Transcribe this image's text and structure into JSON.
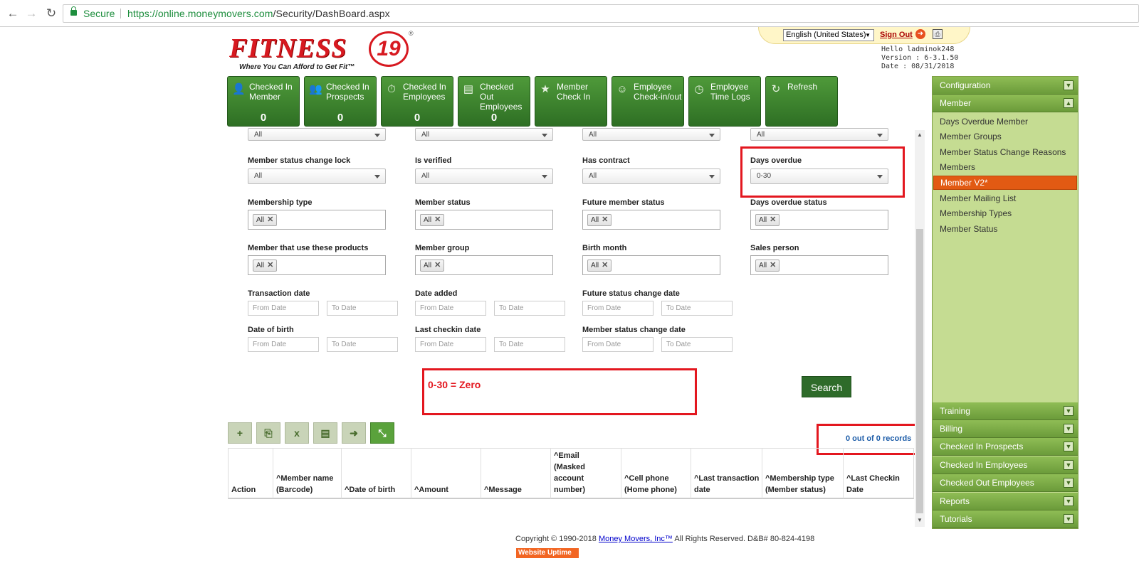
{
  "browser": {
    "secure_label": "Secure",
    "url_scheme_host": "https://online.moneymovers.com",
    "url_path": "/Security/DashBoard.aspx"
  },
  "header": {
    "logo_text": "FITNESS",
    "logo_number": "19",
    "logo_tagline": "Where You Can Afford to Get Fit™",
    "language": "English (United States)",
    "sign_out": "Sign Out",
    "user": {
      "hello": "Hello ladminok248",
      "version": "Version : 6-3.1.50",
      "date": "Date : 08/31/2018"
    }
  },
  "tiles": [
    {
      "label": "Checked In Member",
      "count": "0",
      "icon": "person-icon"
    },
    {
      "label": "Checked In Prospects",
      "count": "0",
      "icon": "people-icon"
    },
    {
      "label": "Checked In Employees",
      "count": "0",
      "icon": "stopwatch-icon"
    },
    {
      "label": "Checked Out Employees",
      "count": "0",
      "icon": "badge-icon"
    },
    {
      "label": "Member Check In",
      "count": "",
      "icon": "star-icon"
    },
    {
      "label": "Employee Check-in/out",
      "count": "",
      "icon": "smiley-icon"
    },
    {
      "label": "Employee Time Logs",
      "count": "",
      "icon": "clock-icon"
    },
    {
      "label": "Refresh",
      "count": "",
      "icon": "refresh-icon"
    }
  ],
  "filters": {
    "row0_values": [
      "All",
      "All",
      "All",
      "All"
    ],
    "row1": [
      {
        "label": "Member status change lock",
        "value": "All"
      },
      {
        "label": "Is verified",
        "value": "All"
      },
      {
        "label": "Has contract",
        "value": "All"
      },
      {
        "label": "Days overdue",
        "value": "0-30"
      }
    ],
    "row2": [
      {
        "label": "Membership type",
        "chip": "All"
      },
      {
        "label": "Member status",
        "chip": "All"
      },
      {
        "label": "Future member status",
        "chip": "All"
      },
      {
        "label": "Days overdue status",
        "chip": "All"
      }
    ],
    "row3": [
      {
        "label": "Member that use these products",
        "chip": "All"
      },
      {
        "label": "Member group",
        "chip": "All"
      },
      {
        "label": "Birth month",
        "chip": "All"
      },
      {
        "label": "Sales person",
        "chip": "All"
      }
    ],
    "dates1": [
      {
        "label": "Transaction date",
        "from": "From Date",
        "to": "To Date"
      },
      {
        "label": "Date added",
        "from": "From Date",
        "to": "To Date"
      },
      {
        "label": "Future status change date",
        "from": "From Date",
        "to": "To Date"
      }
    ],
    "dates2": [
      {
        "label": "Date of birth",
        "from": "From Date",
        "to": "To Date"
      },
      {
        "label": "Last checkin date",
        "from": "From Date",
        "to": "To Date"
      },
      {
        "label": "Member status change date",
        "from": "From Date",
        "to": "To Date"
      }
    ]
  },
  "annotation": "0-30 = Zero",
  "search_label": "Search",
  "toolbar": {
    "add": "+",
    "pdf": "pdf-icon",
    "excel": "excel-icon",
    "doc": "document-icon",
    "export": "export-icon",
    "collapse": "collapse-icon"
  },
  "records_text": "0 out of 0 records",
  "grid_headers": [
    "Action",
    "^Member name (Barcode)",
    "^Date of birth",
    "^Amount",
    "^Message",
    "^Email (Masked account number)",
    "^Cell phone (Home phone)",
    "^Last transaction date",
    "^Membership type (Member status)",
    "^Last Checkin Date"
  ],
  "footer": {
    "copyright": "Copyright © 1990-2018",
    "link": "Money Movers, Inc™",
    "rights": "All Rights Reserved.   D&B# 80-824-4198",
    "uptime": "Website Uptime"
  },
  "sidebar": {
    "sections_top": [
      "Configuration",
      "Member"
    ],
    "member_items": [
      "Days Overdue Member",
      "Member Groups",
      "Member Status Change Reasons",
      "Members",
      "Member V2*",
      "Member Mailing List",
      "Membership Types",
      "Member Status"
    ],
    "active_item": "Member V2*",
    "sections_bottom": [
      "Training",
      "Billing",
      "Checked In Prospects",
      "Checked In Employees",
      "Checked Out Employees",
      "Reports",
      "Tutorials"
    ]
  },
  "colors": {
    "brand_red": "#d71920",
    "tile_green": "#3f8530",
    "sidebar_green": "#c5dc92",
    "active_orange": "#e25a13",
    "annotation_red": "#e3171f"
  }
}
